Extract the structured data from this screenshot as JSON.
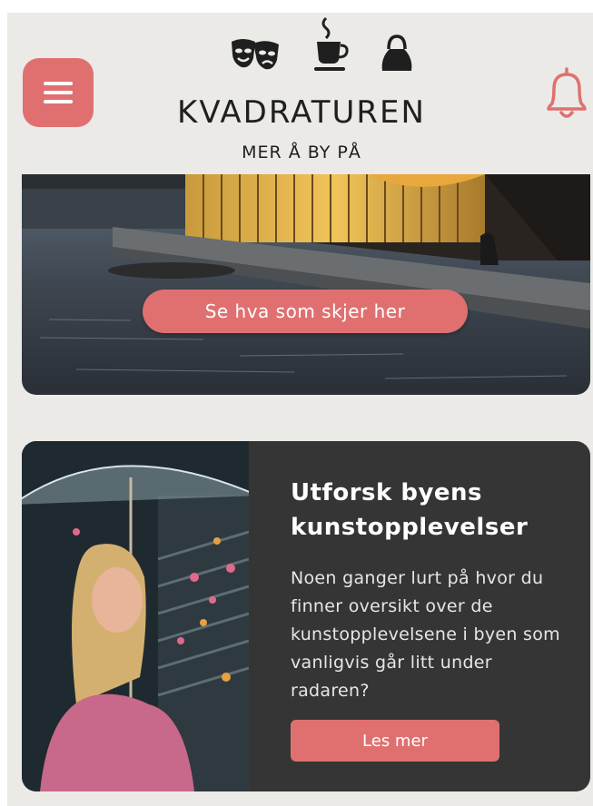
{
  "header": {
    "logo": "KVADRATUREN",
    "tagline": "MER Å BY PÅ",
    "category_icons": [
      "theater-masks-icon",
      "coffee-cup-icon",
      "handbag-icon"
    ],
    "menu_icon": "hamburger-menu-icon",
    "notification_icon": "bell-icon"
  },
  "hero": {
    "button_label": "Se hva som skjer her"
  },
  "feature_card": {
    "title": "Utforsk byens kunstopplevelser",
    "body": "Noen ganger lurt på hvor du finner oversikt over de kunstopplevelsene i byen som vanligvis går litt under radaren?",
    "button_label": "Les mer"
  },
  "colors": {
    "accent": "#e07070",
    "background": "#ebeae6",
    "card_background": "#353535",
    "text_dark": "#1f1f1f"
  }
}
